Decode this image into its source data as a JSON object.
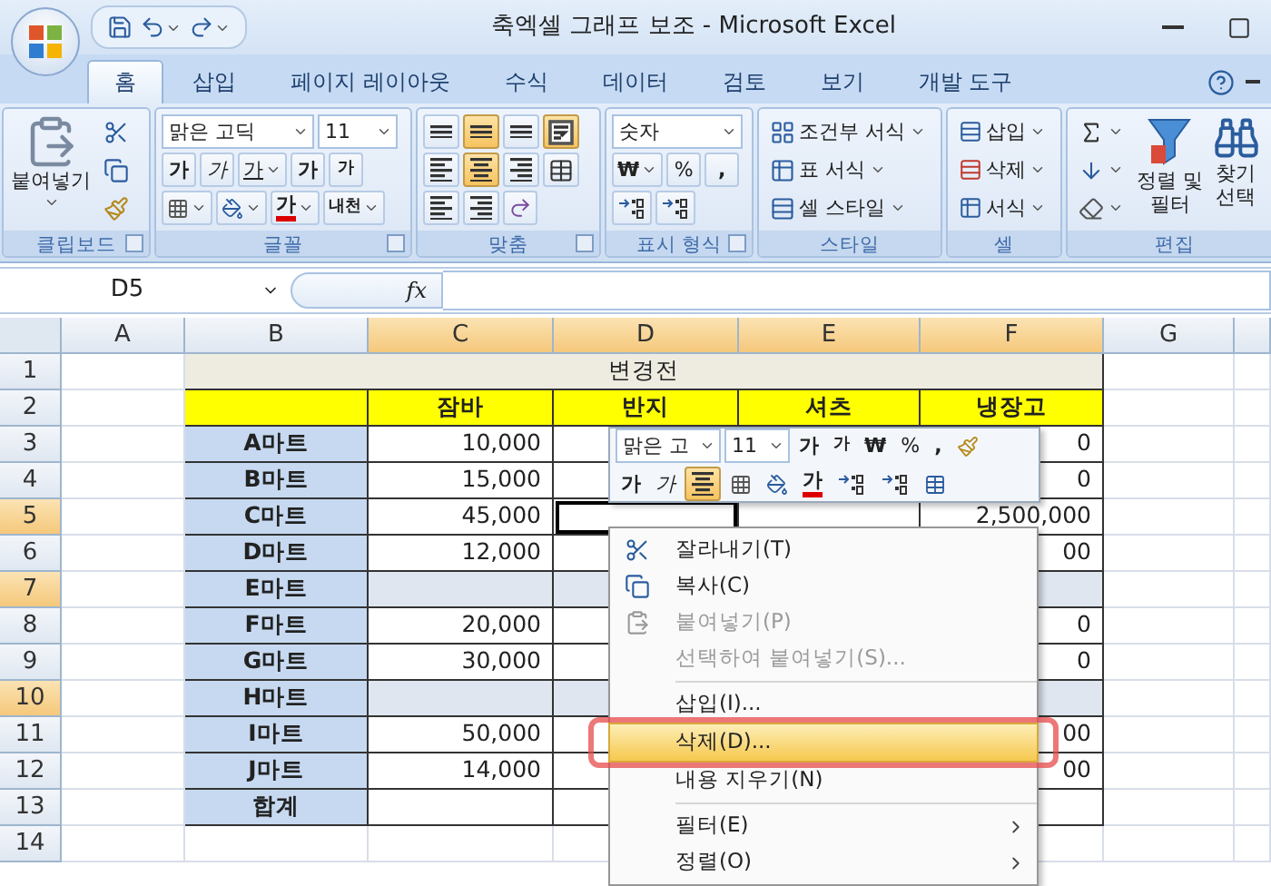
{
  "window": {
    "title": "축엑셀 그래프 보조 - Microsoft Excel"
  },
  "tabs": [
    {
      "label": "홈",
      "selected": true
    },
    {
      "label": "삽입",
      "selected": false
    },
    {
      "label": "페이지 레이아웃",
      "selected": false
    },
    {
      "label": "수식",
      "selected": false
    },
    {
      "label": "데이터",
      "selected": false
    },
    {
      "label": "검토",
      "selected": false
    },
    {
      "label": "보기",
      "selected": false
    },
    {
      "label": "개발 도구",
      "selected": false
    }
  ],
  "ribbon": [
    {
      "kind": "clipboard",
      "label": "클립보드",
      "paste": "붙여넣기"
    },
    {
      "kind": "font",
      "label": "글꼴",
      "font": "맑은 고딕",
      "size": "11",
      "bold": "가",
      "italic": "가",
      "underline": "가",
      "grow": "가",
      "shrink": "가",
      "color_glyph": "가",
      "phonetic": "내천"
    },
    {
      "kind": "alignment",
      "label": "맞춤",
      "buttons": [
        {
          "on": false
        },
        {
          "on": true
        },
        {
          "on": false
        },
        {
          "on": true
        },
        {
          "on": false
        },
        {
          "on": true
        },
        {
          "on": false
        },
        {
          "on": false
        },
        {
          "on": false
        },
        {
          "on": false
        },
        {
          "on": false
        }
      ]
    },
    {
      "kind": "number",
      "label": "표시 형식",
      "format": "숫자",
      "currency": "₩",
      "percent": "%",
      "comma": ","
    },
    {
      "kind": "styles",
      "label": "스타일",
      "items": [
        "조건부 서식",
        "표 서식",
        "셀 스타일"
      ]
    },
    {
      "kind": "cells",
      "label": "셀",
      "items": [
        "삽입",
        "삭제",
        "서식"
      ]
    },
    {
      "kind": "editing",
      "label": "편집",
      "sort": [
        "정렬 및",
        "필터"
      ],
      "find": [
        "찾기",
        "선택"
      ]
    }
  ],
  "formula_bar": {
    "name_box": "D5",
    "fx": "fx"
  },
  "sheet": {
    "columns": [
      {
        "label": "A",
        "selected": false
      },
      {
        "label": "B",
        "selected": false
      },
      {
        "label": "C",
        "selected": true
      },
      {
        "label": "D",
        "selected": true
      },
      {
        "label": "E",
        "selected": true
      },
      {
        "label": "F",
        "selected": true
      },
      {
        "label": "G",
        "selected": false
      }
    ],
    "rows": [
      {
        "number": "1",
        "selected": false,
        "kind": "title",
        "text": "변경전"
      },
      {
        "number": "2",
        "selected": false,
        "kind": "header",
        "cells": {
          "c": "잠바",
          "d": "반지",
          "e": "셔츠",
          "f": "냉장고"
        }
      },
      {
        "number": "3",
        "selected": false,
        "kind": "data",
        "label": "A마트",
        "cells": {
          "c": "10,000",
          "f": "0"
        }
      },
      {
        "number": "4",
        "selected": false,
        "kind": "data",
        "label": "B마트",
        "cells": {
          "c": "15,000",
          "f": "0"
        }
      },
      {
        "number": "5",
        "selected": true,
        "kind": "data",
        "label": "C마트",
        "active": {
          "d": true
        },
        "cells": {
          "c": "45,000",
          "f": "2,500,000"
        }
      },
      {
        "number": "6",
        "selected": false,
        "kind": "data",
        "label": "D마트",
        "cells": {
          "c": "12,000",
          "f": "00"
        }
      },
      {
        "number": "7",
        "selected": true,
        "kind": "data",
        "label": "E마트",
        "shaded": true,
        "cells": {}
      },
      {
        "number": "8",
        "selected": false,
        "kind": "data",
        "label": "F마트",
        "cells": {
          "c": "20,000",
          "f": "0"
        }
      },
      {
        "number": "9",
        "selected": false,
        "kind": "data",
        "label": "G마트",
        "cells": {
          "c": "30,000",
          "f": "0"
        }
      },
      {
        "number": "10",
        "selected": true,
        "kind": "data",
        "label": "H마트",
        "shaded": true,
        "cells": {}
      },
      {
        "number": "11",
        "selected": false,
        "kind": "data",
        "label": "I마트",
        "cells": {
          "c": "50,000",
          "f": "00"
        }
      },
      {
        "number": "12",
        "selected": false,
        "kind": "data",
        "label": "J마트",
        "cells": {
          "c": "14,000",
          "f": "00"
        }
      },
      {
        "number": "13",
        "selected": false,
        "kind": "data",
        "label": "합계",
        "cells": {}
      },
      {
        "number": "14",
        "selected": false,
        "kind": "empty"
      }
    ]
  },
  "mini_toolbar": {
    "font": "맑은 고",
    "size": "11",
    "grow": "가",
    "shrink": "가",
    "currency": "₩",
    "percent": "%",
    "comma": ",",
    "bold": "가",
    "italic": "가",
    "color_glyph": "가",
    "center_on": true
  },
  "context_menu": [
    {
      "label": "잘라내기(T)",
      "disabled": false,
      "selected": false
    },
    {
      "label": "복사(C)",
      "disabled": false,
      "selected": false
    },
    {
      "label": "붙여넣기(P)",
      "disabled": true,
      "selected": false
    },
    {
      "label": "선택하여 붙여넣기(S)...",
      "disabled": true,
      "selected": false
    },
    {
      "label": "삽입(I)...",
      "disabled": false,
      "selected": false,
      "separator_before": true
    },
    {
      "label": "삭제(D)...",
      "disabled": false,
      "selected": true
    },
    {
      "label": "내용 지우기(N)",
      "disabled": false,
      "selected": false
    },
    {
      "label": "필터(E)",
      "disabled": false,
      "selected": false,
      "separator_before": true,
      "submenu": true
    },
    {
      "label": "정렬(O)",
      "disabled": false,
      "selected": false,
      "submenu": true
    }
  ]
}
